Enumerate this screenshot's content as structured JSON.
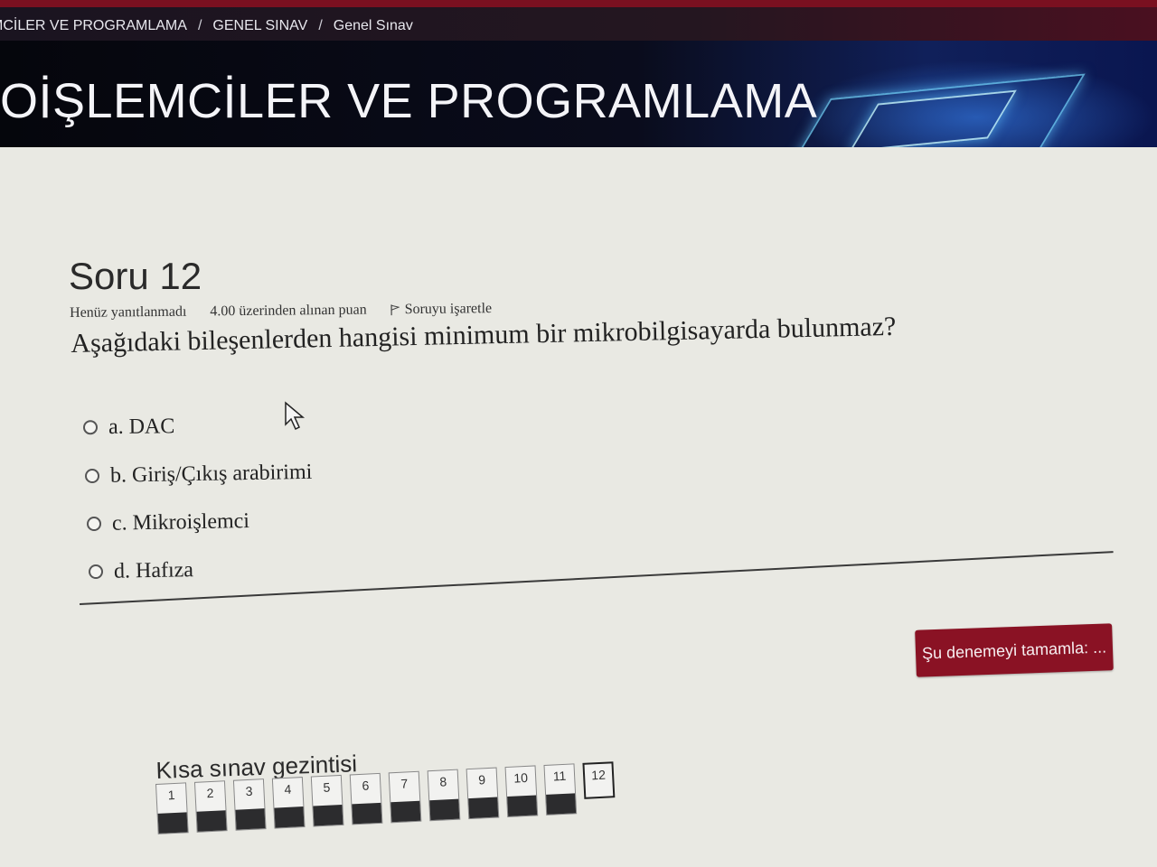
{
  "breadcrumb": {
    "items": [
      "MİKROİŞLEMCİLER VE PROGRAMLAMA",
      "GENEL SINAV",
      "Genel Sınav"
    ],
    "visible_first": "MCİLER VE PROGRAMLAMA",
    "separator": "/"
  },
  "course": {
    "title": "OİŞLEMCİLER VE PROGRAMLAMA"
  },
  "question": {
    "title": "Soru 12",
    "status": "Henüz yanıtlanmadı",
    "points": "4.00 üzerinden alınan puan",
    "flag_label": "Soruyu işaretle",
    "text": "Aşağıdaki bileşenlerden hangisi minimum bir mikrobilgisayarda bulunmaz?",
    "answers": [
      {
        "label": "a. DAC"
      },
      {
        "label": "b. Giriş/Çıkış arabirimi"
      },
      {
        "label": "c. Mikroişlemci"
      },
      {
        "label": "d. Hafıza"
      }
    ]
  },
  "actions": {
    "finish_label": "Şu denemeyi tamamla: ..."
  },
  "nav": {
    "title": "Kısa sınav gezintisi",
    "buttons": [
      "1",
      "2",
      "3",
      "4",
      "5",
      "6",
      "7",
      "8",
      "9",
      "10",
      "11",
      "12"
    ],
    "current": "12"
  },
  "colors": {
    "accent": "#8a1224",
    "banner": "#0a0c1c"
  }
}
